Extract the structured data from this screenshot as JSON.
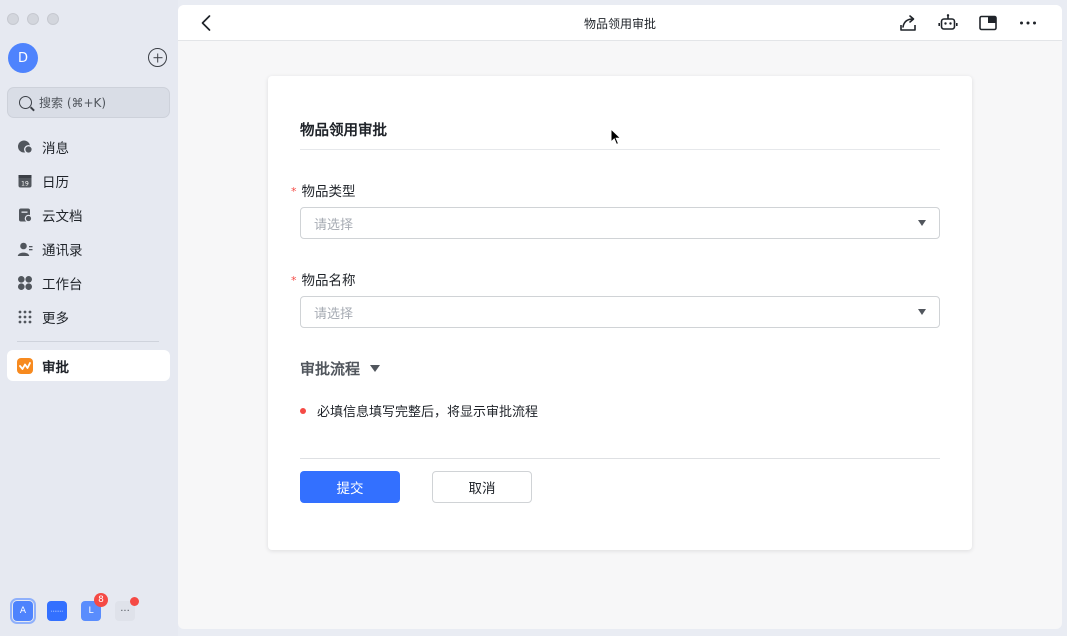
{
  "sidebar": {
    "avatar_letter": "D",
    "search_placeholder": "搜索 (⌘+K)",
    "items": [
      {
        "label": "消息",
        "icon": "message-icon"
      },
      {
        "label": "日历",
        "icon": "calendar-icon"
      },
      {
        "label": "云文档",
        "icon": "docs-icon"
      },
      {
        "label": "通讯录",
        "icon": "contacts-icon"
      },
      {
        "label": "工作台",
        "icon": "workplace-icon"
      },
      {
        "label": "更多",
        "icon": "more-grid-icon"
      }
    ],
    "active_app": {
      "label": "审批",
      "icon": "approval-icon",
      "color": "#f78a1f"
    },
    "dock": [
      {
        "label": "A"
      },
      {
        "label": "•••••••"
      },
      {
        "label": "L",
        "badge": "8"
      },
      {
        "label": "···"
      }
    ],
    "calendar_day": "19"
  },
  "topbar": {
    "title": "物品领用审批"
  },
  "form": {
    "title": "物品领用审批",
    "fields": [
      {
        "label": "物品类型",
        "required_mark": "*",
        "placeholder": "请选择"
      },
      {
        "label": "物品名称",
        "required_mark": "*",
        "placeholder": "请选择"
      }
    ],
    "flow_title": "审批流程",
    "flow_note": "必填信息填写完整后，将显示审批流程",
    "submit_label": "提交",
    "cancel_label": "取消"
  },
  "colors": {
    "primary": "#3370ff",
    "required": "#f54a45",
    "avatar": "#4e83fd"
  }
}
